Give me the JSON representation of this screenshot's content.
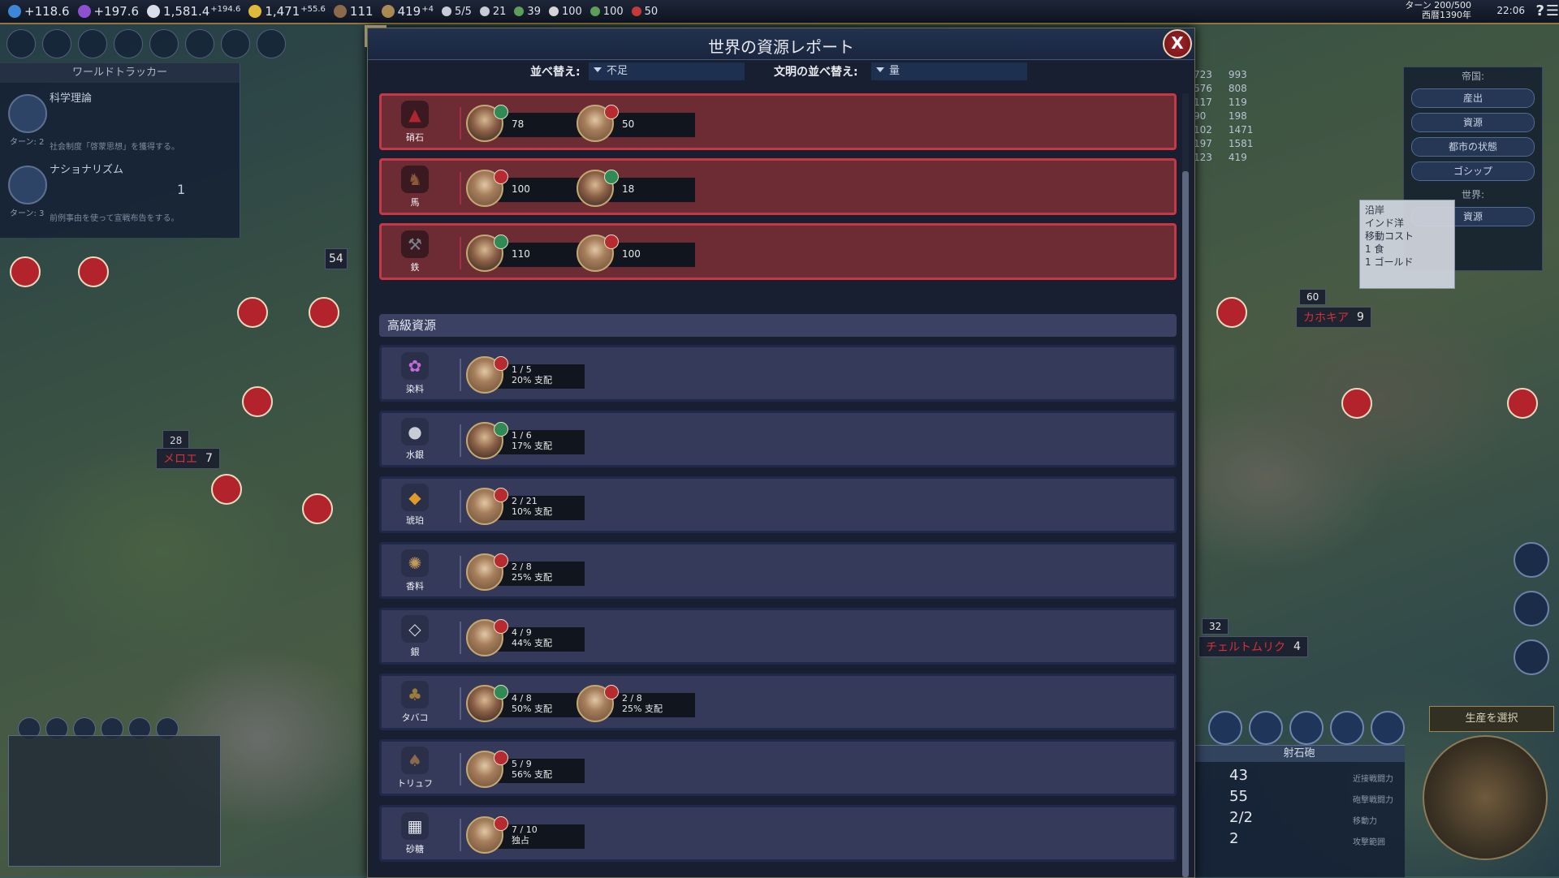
{
  "top_bar": {
    "science": "+118.6",
    "culture": "+197.6",
    "faith": "1,581.4",
    "faith_rate": "+194.6",
    "gold": "1,471",
    "gold_rate": "+55.6",
    "tourism": "111",
    "envoys": "419",
    "envoys_rate": "+4",
    "trade_routes": "5/5",
    "governors": "21",
    "res1": "39",
    "res2": "100",
    "res3": "100",
    "res4": "50",
    "turn": "ターン 200/500",
    "year": "西暦1390年",
    "clock": "22:06",
    "help": "?"
  },
  "left_panel": {
    "tracker_title": "ワールドトラッカー",
    "tech_title": "科学理論",
    "tech_turns": "ターン: 2",
    "tech_desc": "社会制度「啓蒙思想」を獲得する。",
    "civic_title": "ナショナリズム",
    "civic_count": "1",
    "civic_turns": "ターン: 3",
    "civic_desc": "前例事由を使って宣戦布告をする。"
  },
  "map": {
    "city1_name": "メロエ",
    "city1_pop": "7",
    "city1_strength": "28",
    "city2_name": "カホキア",
    "city2_pop": "9",
    "city2_strength": "60",
    "city3_name": "チェルトムリク",
    "city3_pop": "4",
    "city3_strength": "32",
    "badge_54": "54"
  },
  "score_panel": {
    "col1": [
      "723",
      "576",
      "117",
      "90",
      "102",
      "197",
      "123"
    ],
    "col2": [
      "993",
      "808",
      "119",
      "198",
      "1471",
      "1581",
      "419"
    ]
  },
  "report_menu": {
    "empire_label": "帝国:",
    "btn_output": "産出",
    "btn_resources": "資源",
    "btn_city_status": "都市の状態",
    "btn_gossip": "ゴシップ",
    "world_label": "世界:",
    "btn_world_resources": "資源"
  },
  "tooltip": {
    "line1": "沿岸",
    "line2": "インド洋",
    "line3": "移動コスト",
    "line4": "1 食",
    "line5": "1 ゴールド"
  },
  "unit_panel": {
    "name": "射石砲",
    "melee": "43",
    "melee_label": "近接戦闘力",
    "ranged": "55",
    "ranged_label": "砲撃戦闘力",
    "moves": "2/2",
    "moves_label": "移動力",
    "range": "2",
    "range_label": "攻撃範囲",
    "select_production": "生産を選択"
  },
  "dialog": {
    "title": "世界の資源レポート",
    "close": "X",
    "sort_label": "並べ替え:",
    "sort_value": "不足",
    "civ_sort_label": "文明の並べ替え:",
    "civ_sort_value": "量",
    "luxury_header": "高級資源",
    "strategic": [
      {
        "name": "硝石",
        "entries": [
          {
            "leader": "a",
            "value": "78"
          },
          {
            "leader": "b",
            "value": "50"
          }
        ]
      },
      {
        "name": "馬",
        "entries": [
          {
            "leader": "b",
            "value": "100"
          },
          {
            "leader": "a",
            "value": "18"
          }
        ]
      },
      {
        "name": "鉄",
        "entries": [
          {
            "leader": "a",
            "value": "110"
          },
          {
            "leader": "b",
            "value": "100"
          }
        ]
      }
    ],
    "luxury": [
      {
        "name": "染料",
        "entries": [
          {
            "leader": "b",
            "count": "1 / 5",
            "share": "20% 支配"
          }
        ]
      },
      {
        "name": "水銀",
        "entries": [
          {
            "leader": "a",
            "count": "1 / 6",
            "share": "17% 支配"
          }
        ]
      },
      {
        "name": "琥珀",
        "entries": [
          {
            "leader": "b",
            "count": "2 / 21",
            "share": "10% 支配"
          }
        ]
      },
      {
        "name": "香料",
        "entries": [
          {
            "leader": "b",
            "count": "2 / 8",
            "share": "25% 支配"
          }
        ]
      },
      {
        "name": "銀",
        "entries": [
          {
            "leader": "b",
            "count": "4 / 9",
            "share": "44% 支配"
          }
        ]
      },
      {
        "name": "タバコ",
        "entries": [
          {
            "leader": "a",
            "count": "4 / 8",
            "share": "50% 支配"
          },
          {
            "leader": "b",
            "count": "2 / 8",
            "share": "25% 支配"
          }
        ]
      },
      {
        "name": "トリュフ",
        "entries": [
          {
            "leader": "b",
            "count": "5 / 9",
            "share": "56% 支配"
          }
        ]
      },
      {
        "name": "砂糖",
        "entries": [
          {
            "leader": "b",
            "count": "7 / 10",
            "share": "独占"
          }
        ]
      }
    ]
  },
  "colors": {
    "strategic_bg": "#6d2b33",
    "strategic_border": "#c83745",
    "luxury_bg": "#353a5a"
  }
}
